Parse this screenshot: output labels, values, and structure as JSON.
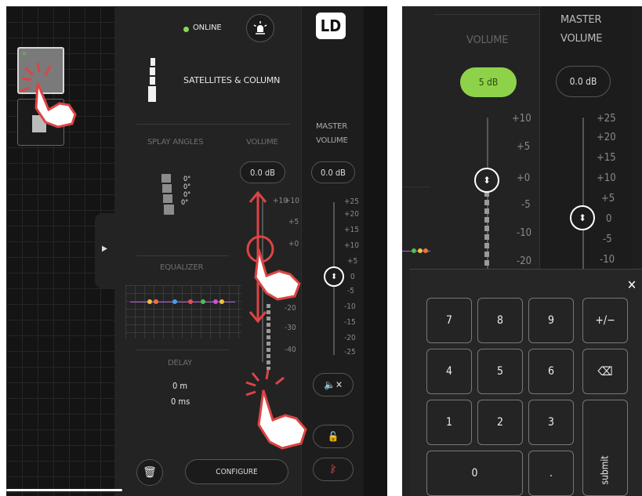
{
  "left": {
    "status": "ONLINE",
    "status_color": "#86d85a",
    "speaker_label": "SATELLITES & COLUMN",
    "splay": {
      "title": "SPLAY ANGLES",
      "angles": [
        "0°",
        "0°",
        "0°",
        "0°"
      ]
    },
    "volume": {
      "title": "VOLUME",
      "value": "0.0 dB",
      "ticks": [
        "+10",
        "+5",
        "+0",
        "-20",
        "-30",
        "-40"
      ]
    },
    "master": {
      "title_line1": "MASTER",
      "title_line2": "VOLUME",
      "value": "0.0 dB",
      "ticks": [
        "+25",
        "+20",
        "+15",
        "+10",
        "+5",
        "0",
        "-5",
        "-10",
        "-15",
        "-20",
        "-25"
      ]
    },
    "equalizer": {
      "title": "EQUALIZER"
    },
    "delay": {
      "title": "DELAY",
      "meters": "0 m",
      "ms": "0 ms"
    },
    "configure_label": "CONFIGURE",
    "logo": "LD"
  },
  "right": {
    "volume_title": "VOLUME",
    "volume_value": "5 dB",
    "volume_value_color": "#8ed24a",
    "volume_ticks": [
      "+10",
      "+5",
      "+0",
      "-5",
      "-10",
      "-20"
    ],
    "master_title_line1": "MASTER",
    "master_title_line2": "VOLUME",
    "master_value": "0.0 dB",
    "master_ticks": [
      "+25",
      "+20",
      "+15",
      "+10",
      "+5",
      "0",
      "-5",
      "-10"
    ],
    "keypad": {
      "k7": "7",
      "k8": "8",
      "k9": "9",
      "kpm": "+/−",
      "k4": "4",
      "k5": "5",
      "k6": "6",
      "k1": "1",
      "k2": "2",
      "k3": "3",
      "k0": "0",
      "kdot": ".",
      "submit": "submit"
    }
  },
  "icons": {
    "online_dot": "status-dot",
    "light": "signal-light-icon",
    "speaker": "speaker-column-icon",
    "mute": "mute-icon",
    "lock": "lock-icon",
    "bluetooth_off": "bluetooth-off-icon",
    "trash": "trash-icon",
    "backspace": "backspace-icon",
    "close": "close-icon",
    "tap": "tap-hand-icon"
  }
}
